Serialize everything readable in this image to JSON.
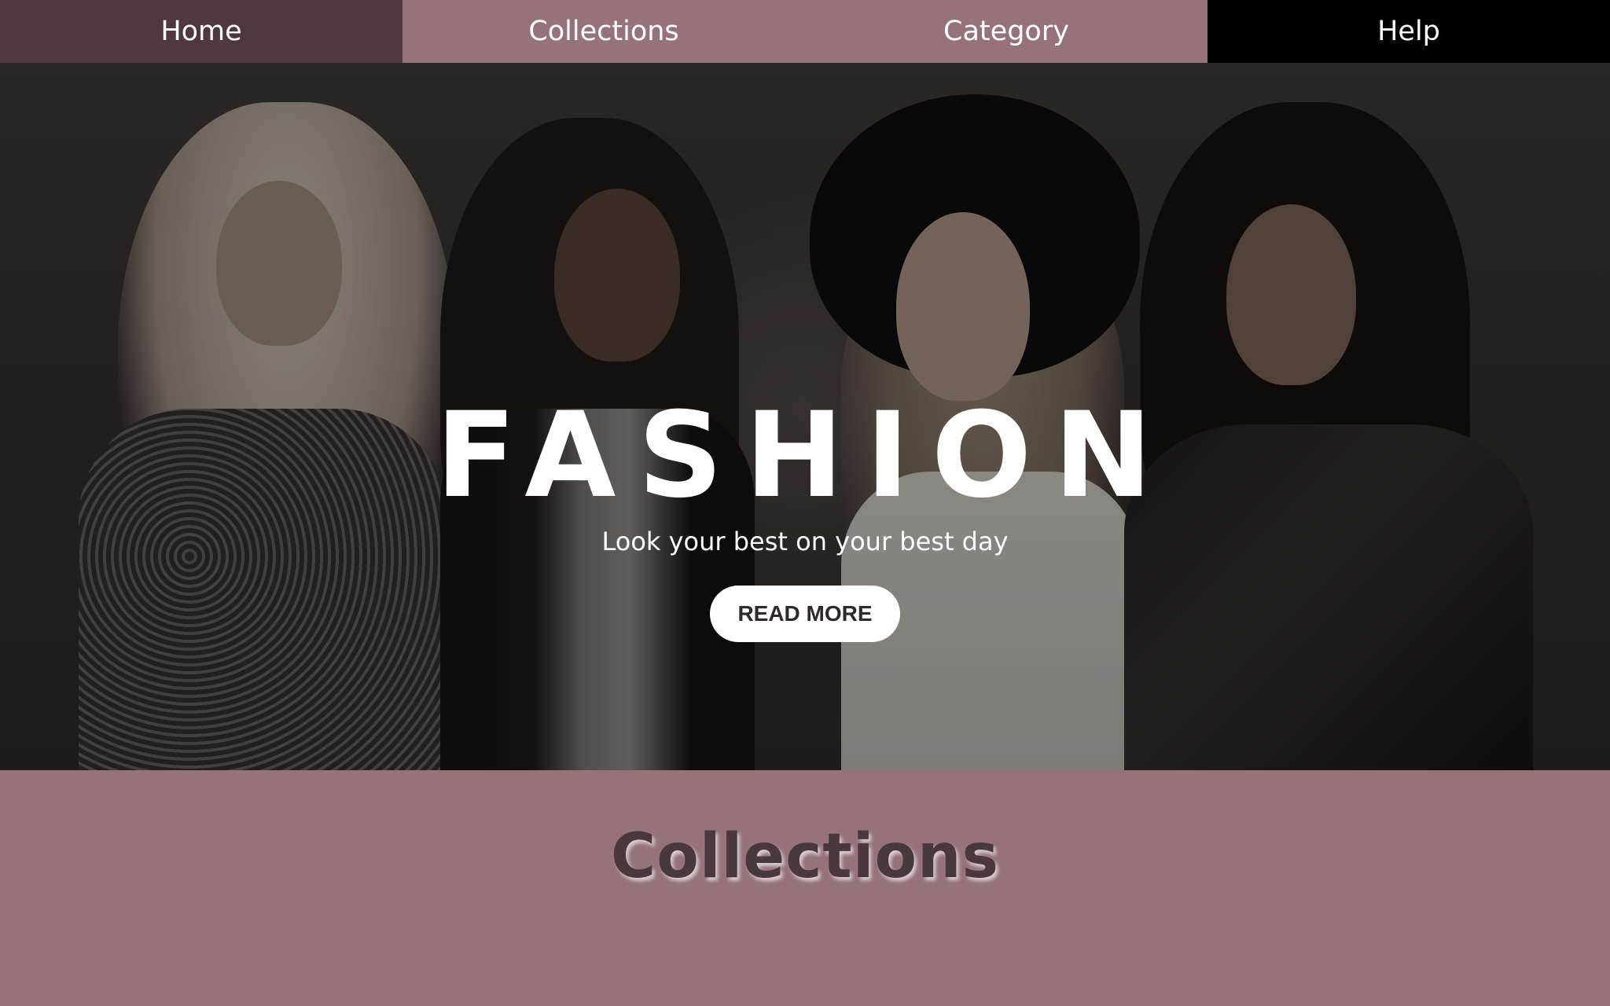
{
  "nav": {
    "items": [
      {
        "label": "Home",
        "color": "#4e393c"
      },
      {
        "label": "Collections",
        "color": "#957378"
      },
      {
        "label": "Category",
        "color": "#957378"
      },
      {
        "label": "Help",
        "color": "#000000"
      }
    ]
  },
  "hero": {
    "title": "FASHION",
    "subtitle": "Look your best on your best day",
    "button_label": "READ MORE"
  },
  "collections": {
    "title": "Collections",
    "background_color": "#957378"
  }
}
